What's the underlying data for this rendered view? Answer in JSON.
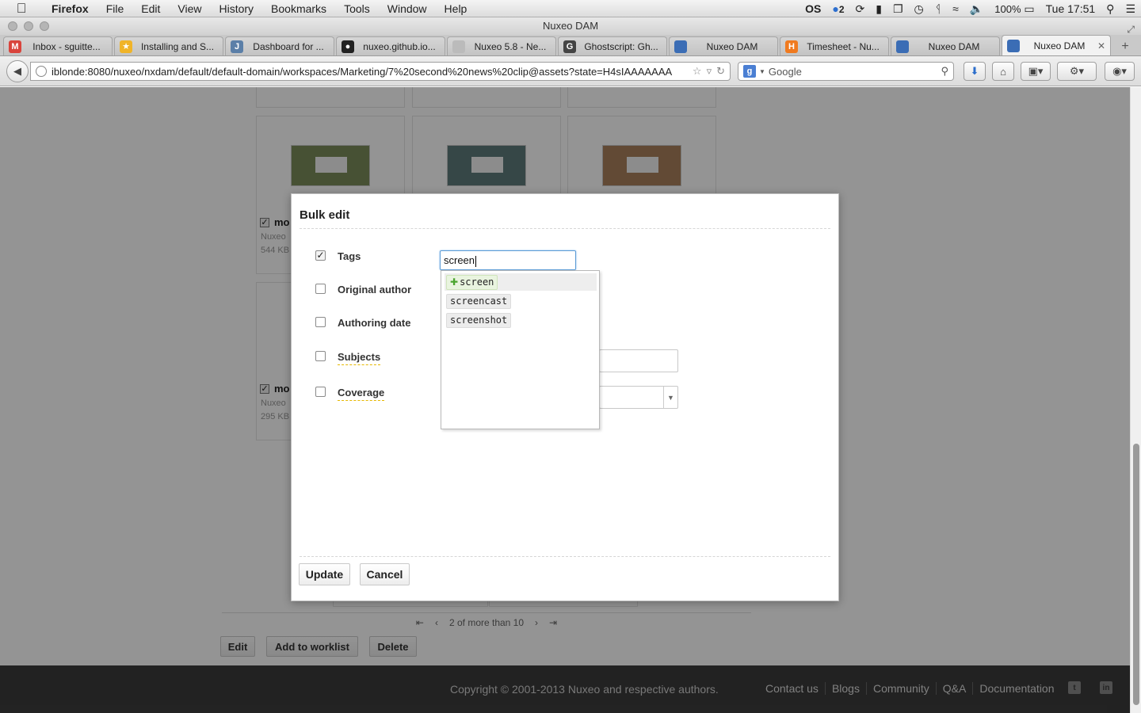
{
  "menubar": {
    "app": "Firefox",
    "items": [
      "File",
      "Edit",
      "View",
      "History",
      "Bookmarks",
      "Tools",
      "Window",
      "Help"
    ],
    "status": {
      "os": "OS",
      "badge": "2",
      "battery": "100%",
      "clock": "Tue 17:51"
    }
  },
  "window": {
    "title": "Nuxeo DAM"
  },
  "tabs": [
    {
      "label": "Inbox - sguitte...",
      "icon": "gmail-icon",
      "color": "#d9443c",
      "glyph": "M"
    },
    {
      "label": "Installing and S...",
      "icon": "star-icon",
      "color": "#f0b429",
      "glyph": "★"
    },
    {
      "label": "Dashboard for ...",
      "icon": "jenkins-icon",
      "color": "#5b7fa8",
      "glyph": "J"
    },
    {
      "label": "nuxeo.github.io...",
      "icon": "github-icon",
      "color": "#222222",
      "glyph": "●"
    },
    {
      "label": "Nuxeo 5.8 - Ne...",
      "icon": "page-icon",
      "color": "#bbbbbb",
      "glyph": ""
    },
    {
      "label": "Ghostscript: Gh...",
      "icon": "ghostscript-icon",
      "color": "#444444",
      "glyph": "G"
    },
    {
      "label": "Nuxeo DAM",
      "icon": "nuxeo-icon",
      "color": "#3b6db5",
      "glyph": ""
    },
    {
      "label": "Timesheet - Nu...",
      "icon": "harvest-icon",
      "color": "#f07a1f",
      "glyph": "H"
    },
    {
      "label": "Nuxeo DAM",
      "icon": "nuxeo-icon",
      "color": "#3b6db5",
      "glyph": ""
    },
    {
      "label": "Nuxeo DAM",
      "icon": "nuxeo-icon",
      "color": "#3b6db5",
      "glyph": "",
      "active": true
    }
  ],
  "navbar": {
    "url": "iblonde:8080/nuxeo/nxdam/default/default-domain/workspaces/Marketing/7%20second%20news%20clip@assets?state=H4sIAAAAAAA",
    "search_placeholder": "Google"
  },
  "background": {
    "cards": [
      {
        "name": "mo",
        "source": "Nuxeo",
        "size": "544 KB",
        "color": "#7b8c5a"
      },
      {
        "name": "mo",
        "source": "Nuxeo",
        "size": "295 KB",
        "color": "#5e7a7a"
      }
    ],
    "pager": {
      "status": "2 of more than 10"
    },
    "actions": {
      "edit": "Edit",
      "worklist": "Add to worklist",
      "delete": "Delete"
    },
    "footer": {
      "copyright": "Copyright © 2001-2013 Nuxeo and respective authors.",
      "links": [
        "Contact us",
        "Blogs",
        "Community",
        "Q&A",
        "Documentation"
      ]
    }
  },
  "modal": {
    "title": "Bulk edit",
    "fields": [
      {
        "label": "Tags",
        "checked": true
      },
      {
        "label": "Original author",
        "checked": false
      },
      {
        "label": "Authoring date",
        "checked": false
      },
      {
        "label": "Subjects",
        "checked": false
      },
      {
        "label": "Coverage",
        "checked": false
      }
    ],
    "tags_input": "screen",
    "suggestions": [
      {
        "label": "screen",
        "new": true
      },
      {
        "label": "screencast",
        "new": false
      },
      {
        "label": "screenshot",
        "new": false
      }
    ],
    "update_label": "Update",
    "cancel_label": "Cancel"
  }
}
